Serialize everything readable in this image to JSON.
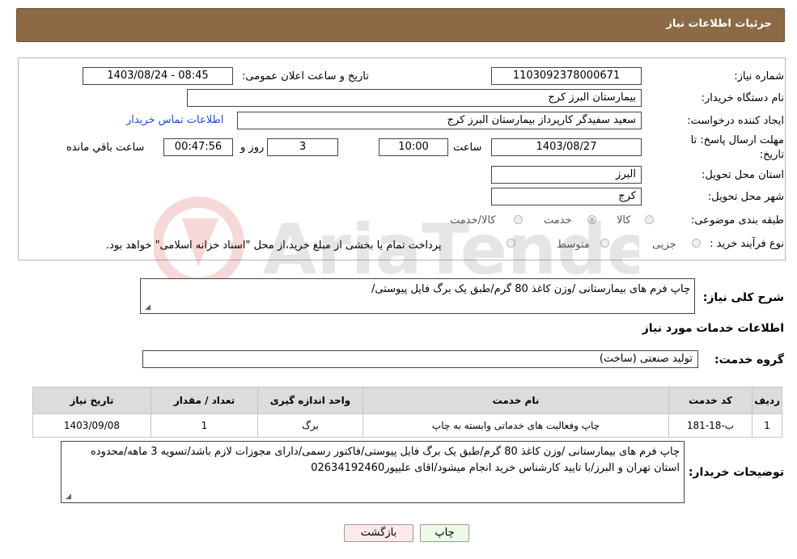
{
  "header": {
    "title": "جزئیات اطلاعات نیاز"
  },
  "form": {
    "need_number_label": "شماره نیاز:",
    "need_number": "1103092378000671",
    "announce_label": "تاریخ و ساعت اعلان عمومی:",
    "announce_value": "1403/08/24 - 08:45",
    "buyer_label": "نام دستگاه خریدار:",
    "buyer_value": "بیمارستان البرز کرج",
    "creator_label": "ایجاد کننده درخواست:",
    "creator_value": "سعید سفیدگر کارپرداز بیمارستان البرز کرج",
    "contact_link": "اطلاعات تماس خریدار",
    "deadline_label_1": "مهلت ارسال پاسخ: تا",
    "deadline_label_2": "تاریخ:",
    "deadline_date": "1403/08/27",
    "time_label": "ساعت",
    "deadline_time": "10:00",
    "days_value": "3",
    "days_label": "روز و",
    "remaining_value": "00:47:56",
    "remaining_label": "ساعت باقي مانده",
    "province_label": "استان محل تحویل:",
    "province_value": "البرز",
    "city_label": "شهر محل تحویل:",
    "city_value": "کرج",
    "category_label": "طبقه بندی موضوعی:",
    "category_options": [
      "کالا",
      "خدمت",
      "کالا/خدمت"
    ],
    "purchase_label": "نوع فرآیند خرید :",
    "purchase_options": [
      "جزیی",
      "متوسط"
    ],
    "purchase_note": "پرداخت تمام یا بخشی از مبلغ خرید،از محل \"اسناد خزانه اسلامی\" خواهد بود."
  },
  "summary": {
    "label": "شرح کلی نیاز:",
    "value": "چاپ فرم های بیمارستانی /وزن کاغذ 80 گرم/طبق یک برگ فایل پیوستی/"
  },
  "services": {
    "section_title": "اطلاعات خدمات مورد نیاز",
    "group_label": "گروه خدمت:",
    "group_value": "تولید صنعتی (ساخت)",
    "columns": [
      "ردیف",
      "کد خدمت",
      "نام خدمت",
      "واحد اندازه گیری",
      "تعداد / مقدار",
      "تاریخ نیاز"
    ],
    "rows": [
      [
        "1",
        "ب-18-181",
        "چاپ وفعالیت های خدماتی وابسته به چاپ",
        "برگ",
        "1",
        "1403/09/08"
      ]
    ]
  },
  "buyer_notes": {
    "label": "توضیحات خریدار:",
    "value": "چاپ فرم های بیمارستانی /وزن کاغذ 80 گرم/طبق یک برگ فایل پیوستی/فاکتور رسمی/دارای مجوزات لازم باشد/تسویه 3 ماهه/محدوده استان تهران و البرز/با تایید کارشناس خرید انجام میشود/اقای علیپور02634192460"
  },
  "buttons": {
    "print": "چاپ",
    "back": "بازگشت"
  },
  "watermark": {
    "text": "AriaTender.neT"
  }
}
